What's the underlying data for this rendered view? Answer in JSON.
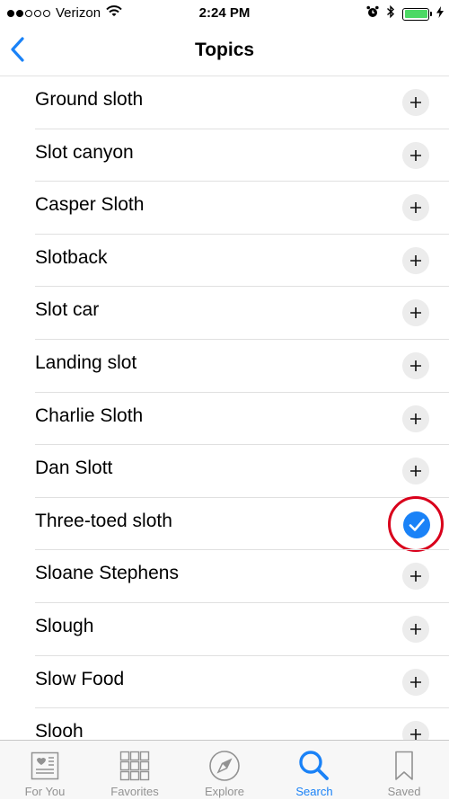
{
  "status_bar": {
    "carrier": "Verizon",
    "time": "2:24 PM",
    "signal_bars_full": 2,
    "signal_bars_total": 5,
    "battery_level": 1.0,
    "battery_color": "#4cd964"
  },
  "nav": {
    "title": "Topics",
    "back_icon": "chevron-left-icon",
    "accent_color": "#1a82f7"
  },
  "topics": [
    {
      "label": "Ground sloth",
      "state": "add"
    },
    {
      "label": "Slot canyon",
      "state": "add"
    },
    {
      "label": "Casper Sloth",
      "state": "add"
    },
    {
      "label": "Slotback",
      "state": "add"
    },
    {
      "label": "Slot car",
      "state": "add"
    },
    {
      "label": "Landing slot",
      "state": "add"
    },
    {
      "label": "Charlie Sloth",
      "state": "add"
    },
    {
      "label": "Dan Slott",
      "state": "add"
    },
    {
      "label": "Three-toed sloth",
      "state": "added"
    },
    {
      "label": "Sloane Stephens",
      "state": "add"
    },
    {
      "label": "Slough",
      "state": "add"
    },
    {
      "label": "Slow Food",
      "state": "add"
    },
    {
      "label": "Slooh",
      "state": "add"
    }
  ],
  "tabs": [
    {
      "label": "For You",
      "icon": "newspaper-icon",
      "active": false
    },
    {
      "label": "Favorites",
      "icon": "grid-icon",
      "active": false
    },
    {
      "label": "Explore",
      "icon": "compass-icon",
      "active": false
    },
    {
      "label": "Search",
      "icon": "search-icon",
      "active": true
    },
    {
      "label": "Saved",
      "icon": "bookmark-icon",
      "active": false
    }
  ]
}
